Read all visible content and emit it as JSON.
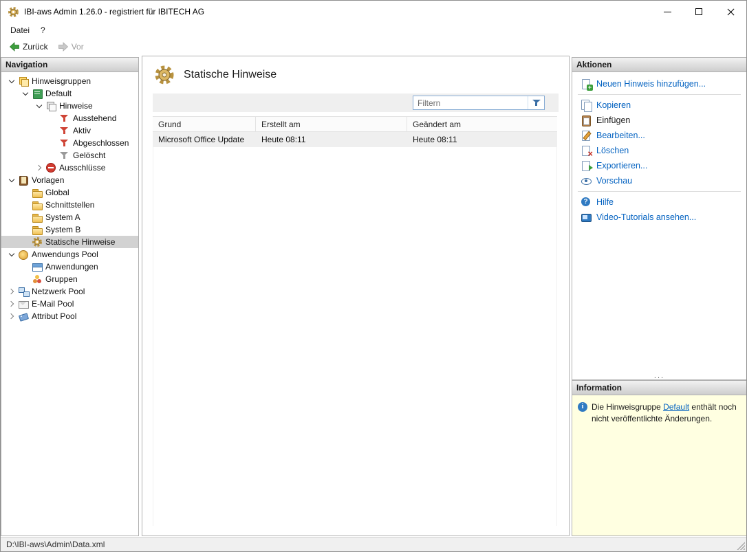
{
  "window": {
    "title": "IBI-aws Admin 1.26.0 - registriert für IBITECH AG"
  },
  "menu": {
    "items": [
      {
        "label": "Datei"
      },
      {
        "label": "?"
      }
    ]
  },
  "toolbar": {
    "back_label": "Zurück",
    "forward_label": "Vor"
  },
  "navigation": {
    "header": "Navigation",
    "items": [
      {
        "label": "Hinweisgruppen"
      },
      {
        "label": "Default"
      },
      {
        "label": "Hinweise"
      },
      {
        "label": "Ausstehend"
      },
      {
        "label": "Aktiv"
      },
      {
        "label": "Abgeschlossen"
      },
      {
        "label": "Gelöscht"
      },
      {
        "label": "Ausschlüsse"
      },
      {
        "label": "Vorlagen"
      },
      {
        "label": "Global"
      },
      {
        "label": "Schnittstellen"
      },
      {
        "label": "System A"
      },
      {
        "label": "System B"
      },
      {
        "label": "Statische Hinweise"
      },
      {
        "label": "Anwendungs Pool"
      },
      {
        "label": "Anwendungen"
      },
      {
        "label": "Gruppen"
      },
      {
        "label": "Netzwerk Pool"
      },
      {
        "label": "E-Mail Pool"
      },
      {
        "label": "Attribut Pool"
      }
    ]
  },
  "main": {
    "title": "Statische Hinweise",
    "filter_placeholder": "Filtern",
    "table": {
      "columns": [
        "Grund",
        "Erstellt am",
        "Geändert am"
      ],
      "rows": [
        [
          "Microsoft Office Update",
          "Heute 08:11",
          "Heute 08:11"
        ]
      ]
    }
  },
  "actions": {
    "header": "Aktionen",
    "items": [
      {
        "label": "Neuen Hinweis hinzufügen..."
      },
      {
        "label": "Kopieren"
      },
      {
        "label": "Einfügen"
      },
      {
        "label": "Bearbeiten..."
      },
      {
        "label": "Löschen"
      },
      {
        "label": "Exportieren..."
      },
      {
        "label": "Vorschau"
      },
      {
        "label": "Hilfe"
      },
      {
        "label": "Video-Tutorials ansehen..."
      }
    ],
    "resize_grip": "..."
  },
  "information": {
    "header": "Information",
    "text_before": "Die Hinweisgruppe ",
    "link": "Default",
    "text_after": " enthält noch nicht veröffentlichte Änderungen."
  },
  "statusbar": {
    "path": "D:\\IBI-aws\\Admin\\Data.xml"
  }
}
